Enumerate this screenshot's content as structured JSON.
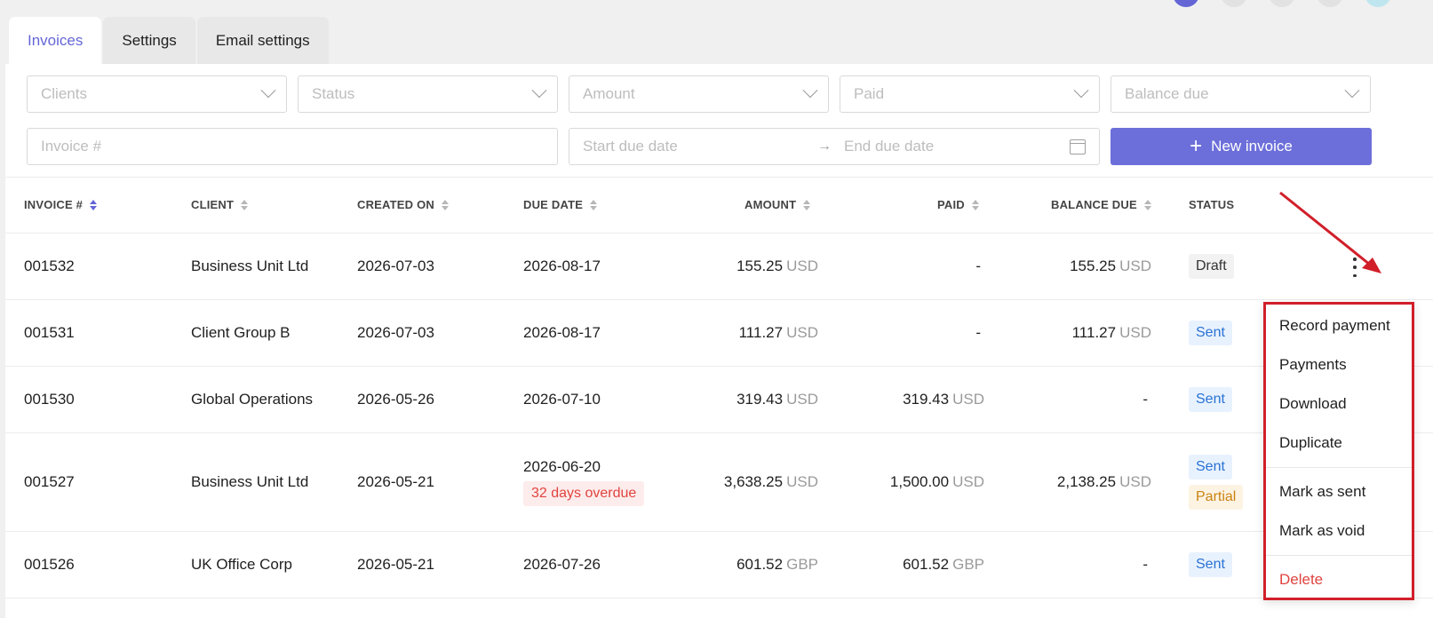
{
  "tabs": [
    {
      "label": "Invoices",
      "active": true
    },
    {
      "label": "Settings",
      "active": false
    },
    {
      "label": "Email settings",
      "active": false
    }
  ],
  "filters": {
    "clients_placeholder": "Clients",
    "status_placeholder": "Status",
    "amount_placeholder": "Amount",
    "paid_placeholder": "Paid",
    "balance_placeholder": "Balance due",
    "invoice_placeholder": "Invoice #",
    "start_date_placeholder": "Start due date",
    "end_date_placeholder": "End due date",
    "date_arrow": "→"
  },
  "new_invoice_button": {
    "icon": "+",
    "label": "New invoice"
  },
  "table": {
    "headers": {
      "invoice": "INVOICE #",
      "client": "CLIENT",
      "created": "CREATED ON",
      "due": "DUE DATE",
      "amount": "AMOUNT",
      "paid": "PAID",
      "balance": "BALANCE DUE",
      "status": "STATUS"
    },
    "rows": [
      {
        "invoice": "001532",
        "client": "Business Unit Ltd",
        "created": "2026-07-03",
        "due": "2026-08-17",
        "overdue": "",
        "amount": "155.25",
        "amount_cur": "USD",
        "paid": "-",
        "paid_cur": "",
        "balance": "155.25",
        "balance_cur": "USD",
        "status": "Draft",
        "status2": ""
      },
      {
        "invoice": "001531",
        "client": "Client Group B",
        "created": "2026-07-03",
        "due": "2026-08-17",
        "overdue": "",
        "amount": "111.27",
        "amount_cur": "USD",
        "paid": "-",
        "paid_cur": "",
        "balance": "111.27",
        "balance_cur": "USD",
        "status": "Sent",
        "status2": ""
      },
      {
        "invoice": "001530",
        "client": "Global Operations",
        "created": "2026-05-26",
        "due": "2026-07-10",
        "overdue": "",
        "amount": "319.43",
        "amount_cur": "USD",
        "paid": "319.43",
        "paid_cur": "USD",
        "balance": "-",
        "balance_cur": "",
        "status": "Sent",
        "status2": ""
      },
      {
        "invoice": "001527",
        "client": "Business Unit Ltd",
        "created": "2026-05-21",
        "due": "2026-06-20",
        "overdue": "32 days overdue",
        "amount": "3,638.25",
        "amount_cur": "USD",
        "paid": "1,500.00",
        "paid_cur": "USD",
        "balance": "2,138.25",
        "balance_cur": "USD",
        "status": "Sent",
        "status2": "Partial"
      },
      {
        "invoice": "001526",
        "client": "UK Office Corp",
        "created": "2026-05-21",
        "due": "2026-07-26",
        "overdue": "",
        "amount": "601.52",
        "amount_cur": "GBP",
        "paid": "601.52",
        "paid_cur": "GBP",
        "balance": "-",
        "balance_cur": "",
        "status": "Sent",
        "status2": ""
      }
    ]
  },
  "context_menu": {
    "items": [
      "Record payment",
      "Payments",
      "Download",
      "Duplicate"
    ],
    "items2": [
      "Mark as sent",
      "Mark as void"
    ],
    "delete": "Delete"
  },
  "colors": {
    "accent": "#6c6fd9",
    "danger": "#e0443f",
    "highlight_box": "#d11f2a"
  }
}
